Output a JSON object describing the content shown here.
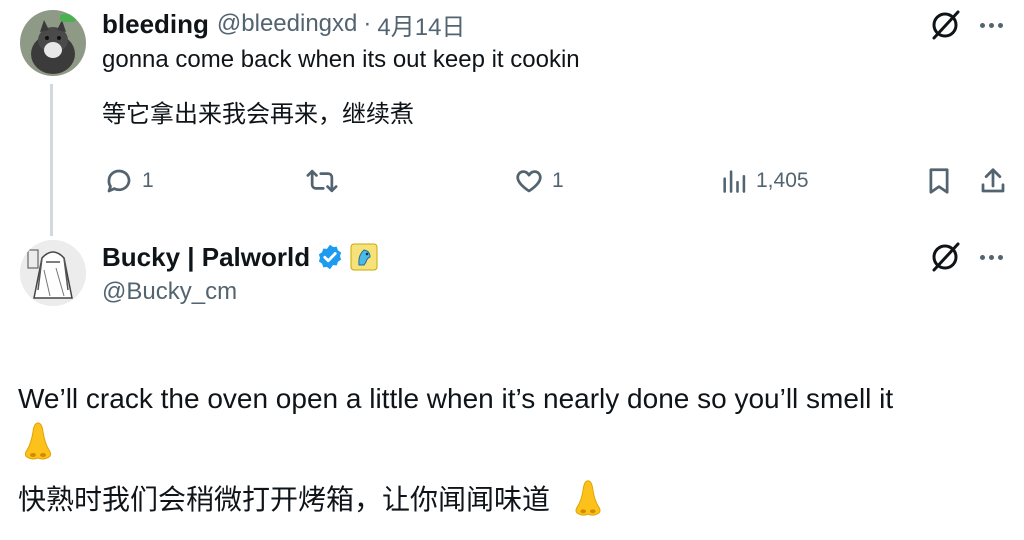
{
  "tweet1": {
    "display_name": "bleeding",
    "handle": "@bleedingxd",
    "separator": "·",
    "date": "4月14日",
    "text_en": "gonna come back when its out keep it cookin",
    "text_zh": "等它拿出来我会再来，继续煮",
    "replies": "1",
    "likes": "1",
    "views": "1,405"
  },
  "tweet2": {
    "display_name": "Bucky | Palworld",
    "handle": "@Bucky_cm",
    "text_en": "We’ll crack the oven open a little when it’s nearly done so you’ll smell it",
    "text_zh": "快熟时我们会稍微打开烤箱，让你闻闻味道"
  },
  "icons": {
    "reply": "speech-bubble-icon",
    "retweet": "retweet-icon",
    "like": "heart-icon",
    "views": "bar-chart-icon",
    "bookmark": "bookmark-icon",
    "share": "share-upload-icon",
    "grok": "grok-slash-circle-icon",
    "more": "more-dots-icon",
    "verified": "verified-badge-icon",
    "affiliate": "palworld-affiliate-badge-icon",
    "nose": "nose-emoji-icon"
  },
  "colors": {
    "text": "#0f1419",
    "muted": "#536471",
    "verified_blue": "#1d9bf0",
    "thread_line": "#cfd9de"
  }
}
